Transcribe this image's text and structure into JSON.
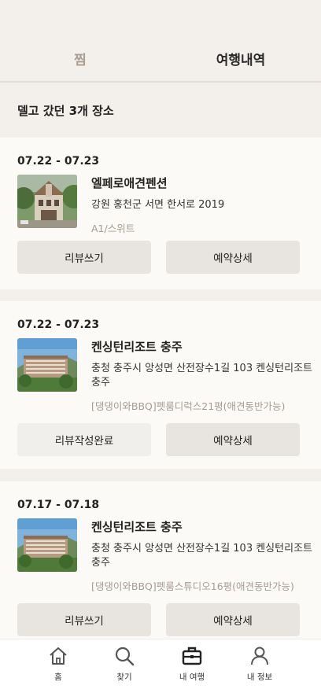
{
  "tabs": {
    "favorites": "찜",
    "history": "여행내역"
  },
  "section_title": "델고 갔던 3개 장소",
  "cards": [
    {
      "dates": "07.22 - 07.23",
      "name": "엘페로애견펜션",
      "address": "강원 홍천군 서면 한서로 2019",
      "room": "A1/스위트",
      "left_button": "리뷰쓰기",
      "right_button": "예약상세"
    },
    {
      "dates": "07.22 - 07.23",
      "name": "켄싱턴리조트 충주",
      "address": "충청 충주시 앙성면 산전장수1길 103 켄싱턴리조트 충주",
      "room": "[댕댕이와BBQ]펫룸디럭스21평(애견동반가능)",
      "left_button": "리뷰작성완료",
      "right_button": "예약상세"
    },
    {
      "dates": "07.17 - 07.18",
      "name": "켄싱턴리조트 충주",
      "address": "충청 충주시 앙성면 산전장수1길 103 켄싱턴리조트 충주",
      "room": "[댕댕이와BBQ]펫룸스튜디오16평(애견동반가능)",
      "left_button": "리뷰쓰기",
      "right_button": "예약상세"
    }
  ],
  "bottom_nav": [
    {
      "label": "홈",
      "icon": "home-icon"
    },
    {
      "label": "찾기",
      "icon": "search-icon"
    },
    {
      "label": "내 여행",
      "icon": "briefcase-icon"
    },
    {
      "label": "내 정보",
      "icon": "person-icon"
    }
  ]
}
